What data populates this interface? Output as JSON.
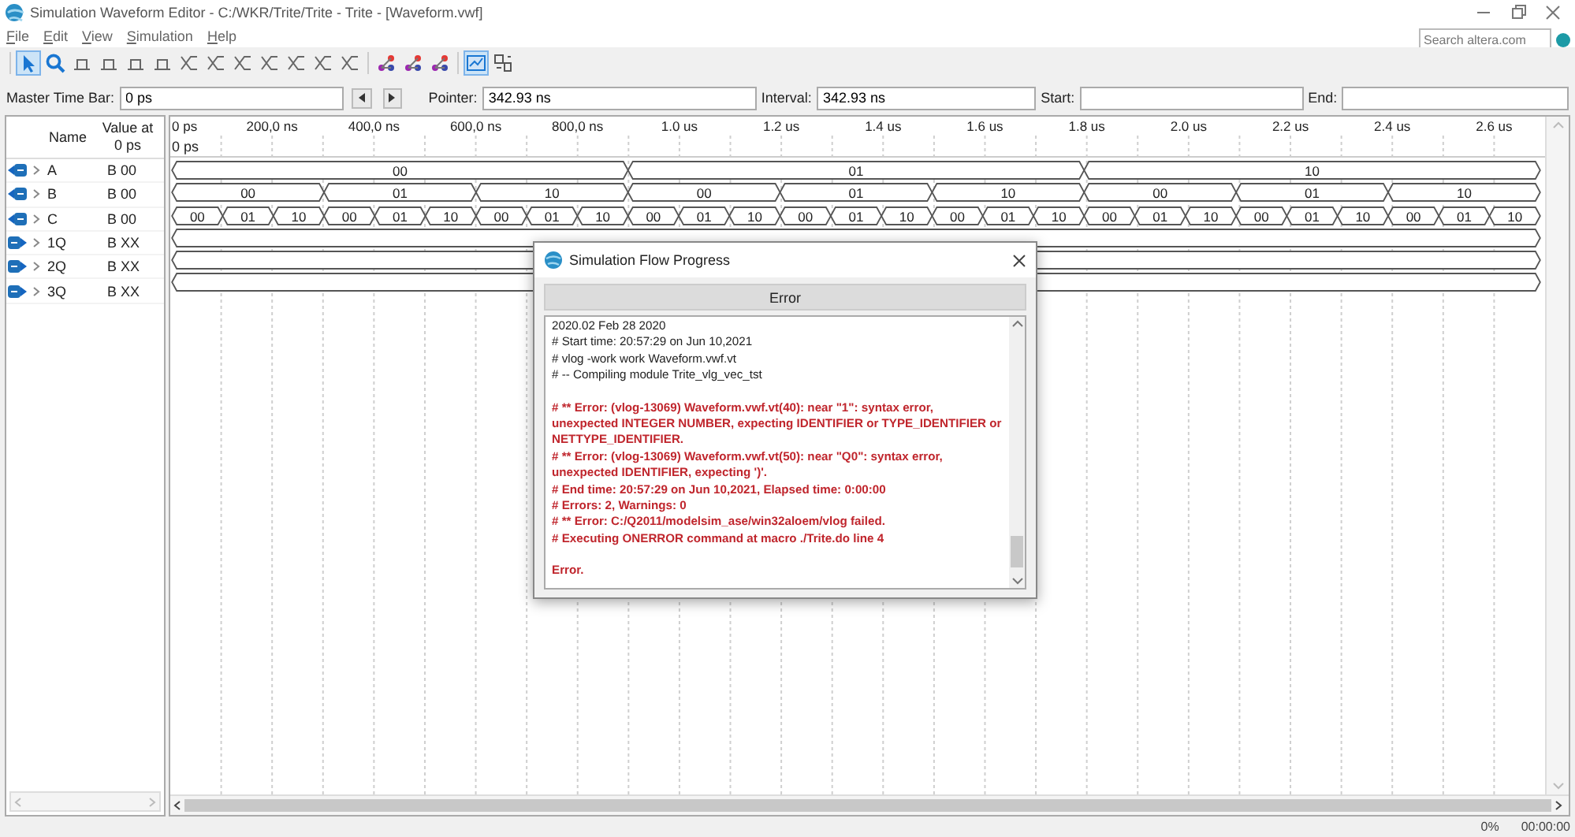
{
  "window": {
    "title": "Simulation Waveform Editor - C:/WKR/Trite/Trite - Trite - [Waveform.vwf]"
  },
  "menu": [
    "File",
    "Edit",
    "View",
    "Simulation",
    "Help"
  ],
  "search": {
    "placeholder": "Search altera.com"
  },
  "toolbar": [
    {
      "kind": "pointer",
      "selected": true
    },
    {
      "kind": "zoom",
      "selected": false
    },
    {
      "kind": "level",
      "selected": false
    },
    {
      "kind": "level",
      "selected": false
    },
    {
      "kind": "level",
      "selected": false
    },
    {
      "kind": "level",
      "selected": false
    },
    {
      "kind": "bus",
      "selected": false
    },
    {
      "kind": "bus",
      "selected": false
    },
    {
      "kind": "bus",
      "selected": false
    },
    {
      "kind": "bus",
      "selected": false
    },
    {
      "kind": "bus",
      "selected": false
    },
    {
      "kind": "bus",
      "selected": false
    },
    {
      "kind": "bus",
      "selected": false
    },
    {
      "kind": "node",
      "selected": false
    },
    {
      "kind": "node",
      "selected": false
    },
    {
      "kind": "node",
      "selected": false
    },
    {
      "kind": "grid",
      "selected": true
    },
    {
      "kind": "snap",
      "selected": false
    }
  ],
  "time_bar": [
    {
      "label": "Master Time Bar:",
      "value": "0 ps"
    },
    {
      "label": "Pointer:",
      "value": "342.93 ns"
    },
    {
      "label": "Interval:",
      "value": "342.93 ns"
    },
    {
      "label": "Start:"
    },
    {
      "label": "End:"
    }
  ],
  "signal_list": {
    "columns": [
      "Name",
      "Value at 0 ps"
    ]
  },
  "timescale": {
    "ticks": [
      "0 ps",
      "200,0 ns",
      "400,0 ns",
      "600,0 ns",
      "800,0 ns",
      "1.0 us",
      "1.2 us",
      "1.4 us",
      "1.6 us",
      "1.8 us",
      "2.0 us",
      "2.2 us",
      "2.4 us",
      "2.6 us"
    ],
    "master_marker": "0 ps"
  },
  "signals": [
    {
      "name": "A",
      "value": "B 00",
      "kind": "input",
      "expanded": false,
      "segments": [
        "00",
        "01",
        "10"
      ]
    },
    {
      "name": "B",
      "value": "B 00",
      "kind": "input",
      "expanded": false,
      "segments": [
        "00",
        "01",
        "10",
        "00",
        "01",
        "10",
        "00",
        "01",
        "10"
      ]
    },
    {
      "name": "C",
      "value": "B 00",
      "kind": "input",
      "expanded": false,
      "segments": [
        "00",
        "01",
        "10",
        "00",
        "01",
        "10",
        "00",
        "01",
        "10",
        "00",
        "01",
        "10",
        "00",
        "01",
        "10",
        "00",
        "01",
        "10",
        "00",
        "01",
        "10",
        "00",
        "01",
        "10",
        "00",
        "01",
        "10"
      ]
    },
    {
      "name": "1Q",
      "value": "B XX",
      "kind": "output",
      "expanded": false
    },
    {
      "name": "2Q",
      "value": "B XX",
      "kind": "output",
      "expanded": false
    },
    {
      "name": "3Q",
      "value": "B XX",
      "kind": "output",
      "expanded": false
    }
  ],
  "dialog": {
    "title": "Simulation Flow Progress",
    "progress": {
      "label": "Error",
      "level": 1
    },
    "log": [
      {
        "kind": "info",
        "text": "2020.02 Feb 28 2020"
      },
      {
        "kind": "info",
        "text": "# Start time: 20:57:29 on Jun 10,2021"
      },
      {
        "kind": "info",
        "text": "# vlog -work work Waveform.vwf.vt"
      },
      {
        "kind": "info",
        "text": "# -- Compiling module Trite_vlg_vec_tst"
      },
      {
        "kind": "error",
        "text": "# ** Error: (vlog-13069) Waveform.vwf.vt(40): near \"1\": syntax error, unexpected INTEGER NUMBER, expecting IDENTIFIER or TYPE_IDENTIFIER or NETTYPE_IDENTIFIER."
      },
      {
        "kind": "error",
        "text": "# ** Error: (vlog-13069) Waveform.vwf.vt(50): near \"Q0\": syntax error, unexpected IDENTIFIER, expecting ')'."
      },
      {
        "kind": "error",
        "text": "# End time: 20:57:29 on Jun 10,2021, Elapsed time: 0:00:00"
      },
      {
        "kind": "error",
        "text": "# Errors: 2, Warnings: 0"
      },
      {
        "kind": "error",
        "text": "# ** Error: C:/Q2011/modelsim_ase/win32aloem/vlog failed."
      },
      {
        "kind": "error",
        "text": "# Executing ONERROR command at macro ./Trite.do line 4"
      },
      {
        "kind": "result",
        "text": "Error."
      }
    ]
  },
  "status_bar": {
    "progress": "0%",
    "elapsed": "00:00:00"
  }
}
